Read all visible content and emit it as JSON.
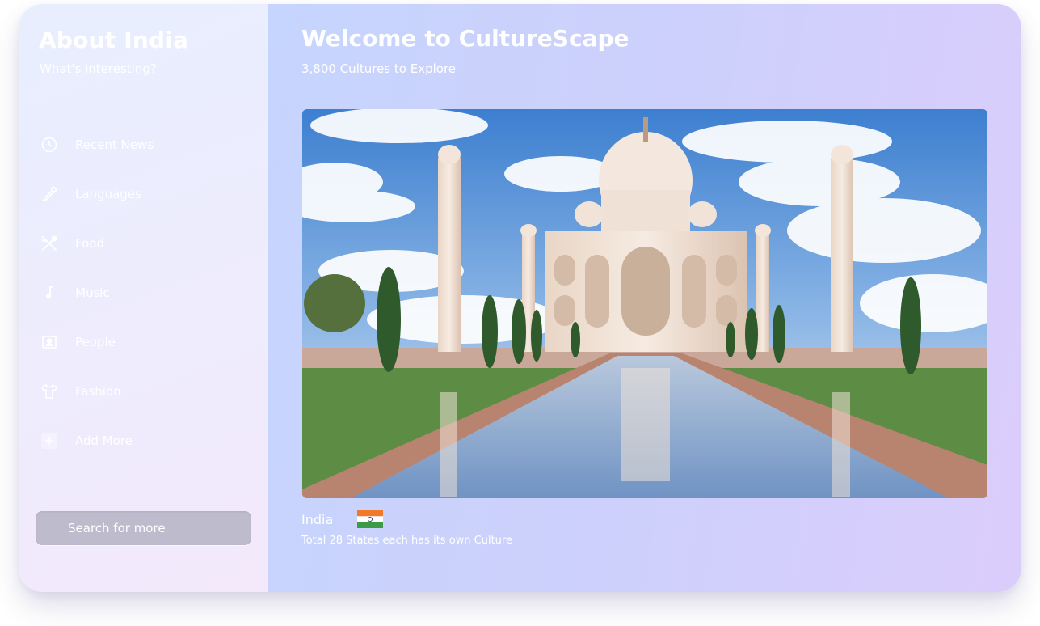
{
  "sidebar": {
    "title": "About India",
    "subtitle": "What's interesting?",
    "items": [
      {
        "label": "Recent News",
        "icon": "clock-icon"
      },
      {
        "label": "Languages",
        "icon": "pen-icon"
      },
      {
        "label": "Food",
        "icon": "utensils-icon"
      },
      {
        "label": "Music",
        "icon": "music-note-icon"
      },
      {
        "label": "People",
        "icon": "person-card-icon"
      },
      {
        "label": "Fashion",
        "icon": "tshirt-icon"
      },
      {
        "label": "Add More",
        "icon": "plus-icon"
      }
    ],
    "search": {
      "placeholder": "Search for more"
    }
  },
  "main": {
    "title": "Welcome to CultureScape",
    "subtitle": "3,800 Cultures to Explore",
    "hero": {
      "icon": "taj-mahal-photo"
    },
    "country": {
      "name": "India",
      "flag_icon": "india-flag-icon",
      "description": "Total 28 States each has its own Culture"
    }
  },
  "colors": {
    "sidebar_bg": "#eceefd",
    "main_bg_start": "#c6d5fd",
    "main_bg_end": "#dbcdfb",
    "search_bg": "#bdbbcc",
    "text": "#ffffff"
  }
}
